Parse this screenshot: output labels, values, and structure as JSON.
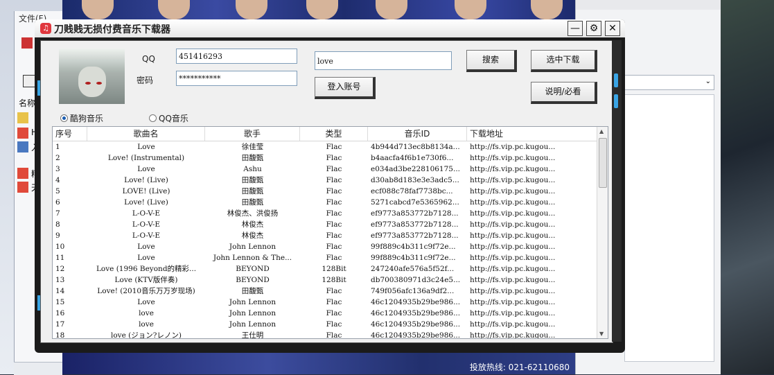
{
  "explorer": {
    "menu_label": "文件(F)",
    "names_label": "名称",
    "file_letters": [
      "H",
      "入",
      "精",
      "天"
    ]
  },
  "banner": {
    "hotline": "投放热线: 021-62110680"
  },
  "window": {
    "title": "刀贱贱无损付费音乐下载器",
    "controls": {
      "minimize": "—",
      "settings": "⚙",
      "close": "✕"
    }
  },
  "login": {
    "qq_label": "QQ",
    "qq_value": "451416293",
    "password_label": "密码",
    "password_value": "***********",
    "login_button": "登入账号"
  },
  "search": {
    "query": "love",
    "search_button": "搜索"
  },
  "actions": {
    "download_selected": "选中下载",
    "help": "说明/必看"
  },
  "source": {
    "kugou": "酷狗音乐",
    "qq": "QQ音乐",
    "selected": "kugou"
  },
  "table": {
    "columns": [
      "序号",
      "歌曲名",
      "歌手",
      "类型",
      "音乐ID",
      "下载地址"
    ],
    "rows": [
      [
        "1",
        "Love",
        "徐佳莹",
        "Flac",
        "4b944d713ec8b8134a...",
        "http://fs.vip.pc.kugou..."
      ],
      [
        "2",
        "Love! (Instrumental)",
        "田馥甄",
        "Flac",
        "b4aacfa4f6b1e730f6...",
        "http://fs.vip.pc.kugou..."
      ],
      [
        "3",
        "Love",
        "Ashu",
        "Flac",
        "e034ad3be228106175...",
        "http://fs.vip.pc.kugou..."
      ],
      [
        "4",
        "Love! (Live)",
        "田馥甄",
        "Flac",
        "d30ab8d183e3e3adc5...",
        "http://fs.vip.pc.kugou..."
      ],
      [
        "5",
        "LOVE! (Live)",
        "田馥甄",
        "Flac",
        "ecf088c78faf7738bc...",
        "http://fs.vip.pc.kugou..."
      ],
      [
        "6",
        "Love! (Live)",
        "田馥甄",
        "Flac",
        "5271cabcd7e5365962...",
        "http://fs.vip.pc.kugou..."
      ],
      [
        "7",
        "L-O-V-E",
        "林俊杰、洪俊扬",
        "Flac",
        "ef9773a853772b7128...",
        "http://fs.vip.pc.kugou..."
      ],
      [
        "8",
        "L-O-V-E",
        "林俊杰",
        "Flac",
        "ef9773a853772b7128...",
        "http://fs.vip.pc.kugou..."
      ],
      [
        "9",
        "L-O-V-E",
        "林俊杰",
        "Flac",
        "ef9773a853772b7128...",
        "http://fs.vip.pc.kugou..."
      ],
      [
        "10",
        "Love",
        "John Lennon",
        "Flac",
        "99f889c4b311c9f72e...",
        "http://fs.vip.pc.kugou..."
      ],
      [
        "11",
        "Love",
        "John Lennon & The...",
        "Flac",
        "99f889c4b311c9f72e...",
        "http://fs.vip.pc.kugou..."
      ],
      [
        "12",
        "Love (1996 Beyond的精彩...",
        "BEYOND",
        "128Bit",
        "247240afe576a5f52f...",
        "http://fs.vip.pc.kugou..."
      ],
      [
        "13",
        "Love (KTV版伴奏)",
        "BEYOND",
        "128Bit",
        "db700380971d3c24e5...",
        "http://fs.vip.pc.kugou..."
      ],
      [
        "14",
        "Love! (2010音乐万万岁现场)",
        "田馥甄",
        "Flac",
        "749f056afc136a9df2...",
        "http://fs.vip.pc.kugou..."
      ],
      [
        "15",
        "Love",
        "John Lennon",
        "Flac",
        "46c1204935b29be986...",
        "http://fs.vip.pc.kugou..."
      ],
      [
        "16",
        "love",
        "John Lennon",
        "Flac",
        "46c1204935b29be986...",
        "http://fs.vip.pc.kugou..."
      ],
      [
        "17",
        "love",
        "John Lennon",
        "Flac",
        "46c1204935b29be986...",
        "http://fs.vip.pc.kugou..."
      ],
      [
        "18",
        "love (ジョン?レノン)",
        "王仕明",
        "Flac",
        "46c1204935b29be986...",
        "http://fs.vip.pc.kugou..."
      ]
    ]
  }
}
